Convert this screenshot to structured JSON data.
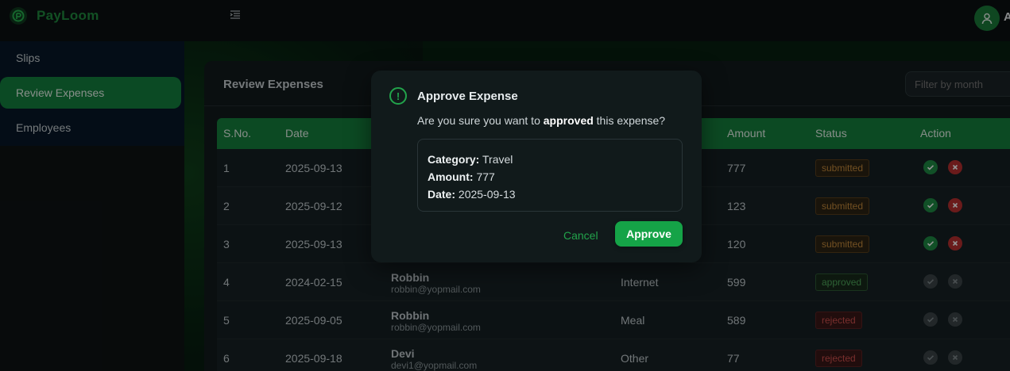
{
  "app": {
    "name": "PayLoom",
    "user_initial": "A"
  },
  "colors": {
    "brand": "#1f8a3e",
    "table_header": "#15803d",
    "approve_button": "#15a347",
    "submitted": "#c58a3c",
    "approved": "#4fa85b",
    "rejected": "#d0514e"
  },
  "sidebar": {
    "items": [
      {
        "label": "Slips",
        "active": false
      },
      {
        "label": "Review Expenses",
        "active": true
      },
      {
        "label": "Employees",
        "active": false
      }
    ]
  },
  "page": {
    "title": "Review Expenses",
    "filter_placeholder": "Filter by month"
  },
  "table": {
    "headers": [
      "S.No.",
      "Date",
      "",
      "",
      "Amount",
      "Status",
      "Action"
    ],
    "rows": [
      {
        "sno": "1",
        "date": "2025-09-13",
        "name": "",
        "email": "",
        "category": "",
        "amount": "777",
        "status": "submitted"
      },
      {
        "sno": "2",
        "date": "2025-09-12",
        "name": "",
        "email": "",
        "category": "",
        "amount": "123",
        "status": "submitted"
      },
      {
        "sno": "3",
        "date": "2025-09-13",
        "name": "",
        "email": "",
        "category": "",
        "amount": "120",
        "status": "submitted"
      },
      {
        "sno": "4",
        "date": "2024-02-15",
        "name": "Robbin",
        "email": "robbin@yopmail.com",
        "category": "Internet",
        "amount": "599",
        "status": "approved"
      },
      {
        "sno": "5",
        "date": "2025-09-05",
        "name": "Robbin",
        "email": "robbin@yopmail.com",
        "category": "Meal",
        "amount": "589",
        "status": "rejected"
      },
      {
        "sno": "6",
        "date": "2025-09-18",
        "name": "Devi",
        "email": "devi1@yopmail.com",
        "category": "Other",
        "amount": "77",
        "status": "rejected"
      }
    ]
  },
  "modal": {
    "title": "Approve Expense",
    "text_before": "Are you sure you want to ",
    "text_bold": "approved",
    "text_after": " this expense?",
    "category_label": "Category:",
    "category_value": "Travel",
    "amount_label": "Amount:",
    "amount_value": "777",
    "date_label": "Date:",
    "date_value": "2025-09-13",
    "cancel_label": "Cancel",
    "approve_label": "Approve"
  }
}
